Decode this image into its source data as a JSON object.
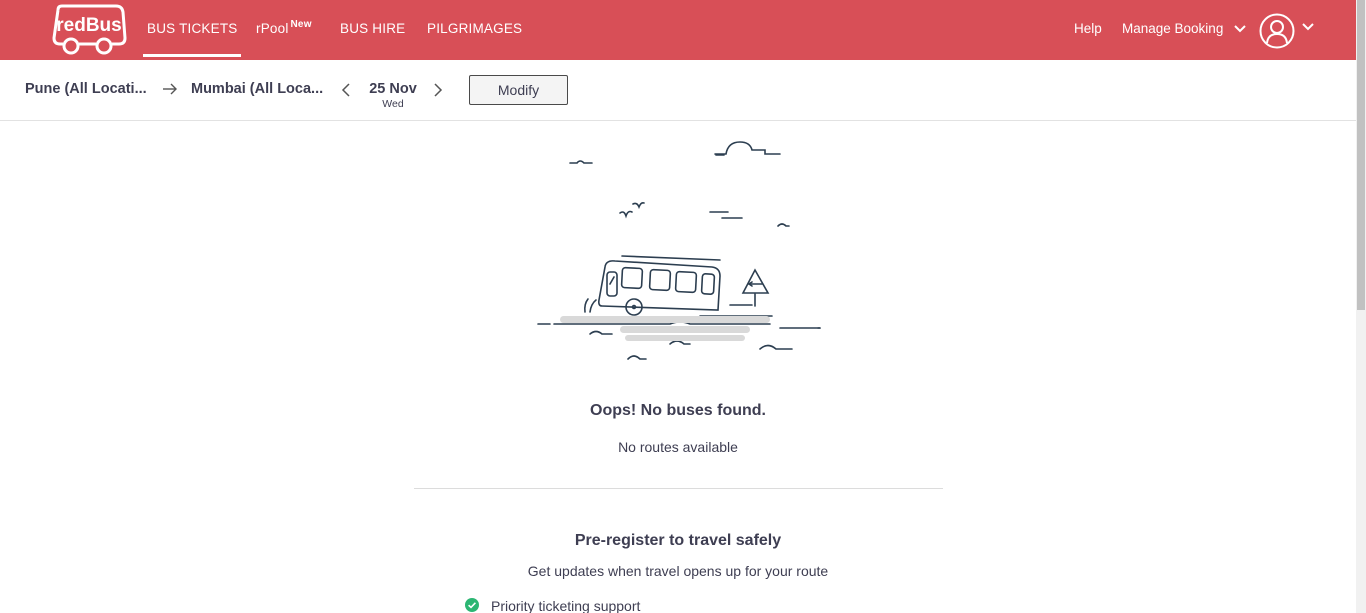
{
  "header": {
    "logo_text": "redBus",
    "nav": [
      {
        "label": "BUS TICKETS",
        "active": true
      },
      {
        "label": "rPool",
        "badge": "New"
      },
      {
        "label": "BUS HIRE"
      },
      {
        "label": "PILGRIMAGES"
      }
    ],
    "help_label": "Help",
    "manage_booking_label": "Manage Booking",
    "brand_color": "#d84f57"
  },
  "search": {
    "from_city": "Pune (All Locati...",
    "to_city": "Mumbai (All Loca...",
    "date": "25 Nov",
    "weekday": "Wed",
    "modify_label": "Modify"
  },
  "empty_state": {
    "title": "Oops! No buses found.",
    "subtitle": "No routes available"
  },
  "preregister": {
    "title": "Pre-register to travel safely",
    "subtitle": "Get updates when travel opens up for your route",
    "benefits": [
      {
        "icon": "check-circle-icon",
        "label": "Priority ticketing support"
      }
    ],
    "check_color": "#2cb673"
  }
}
